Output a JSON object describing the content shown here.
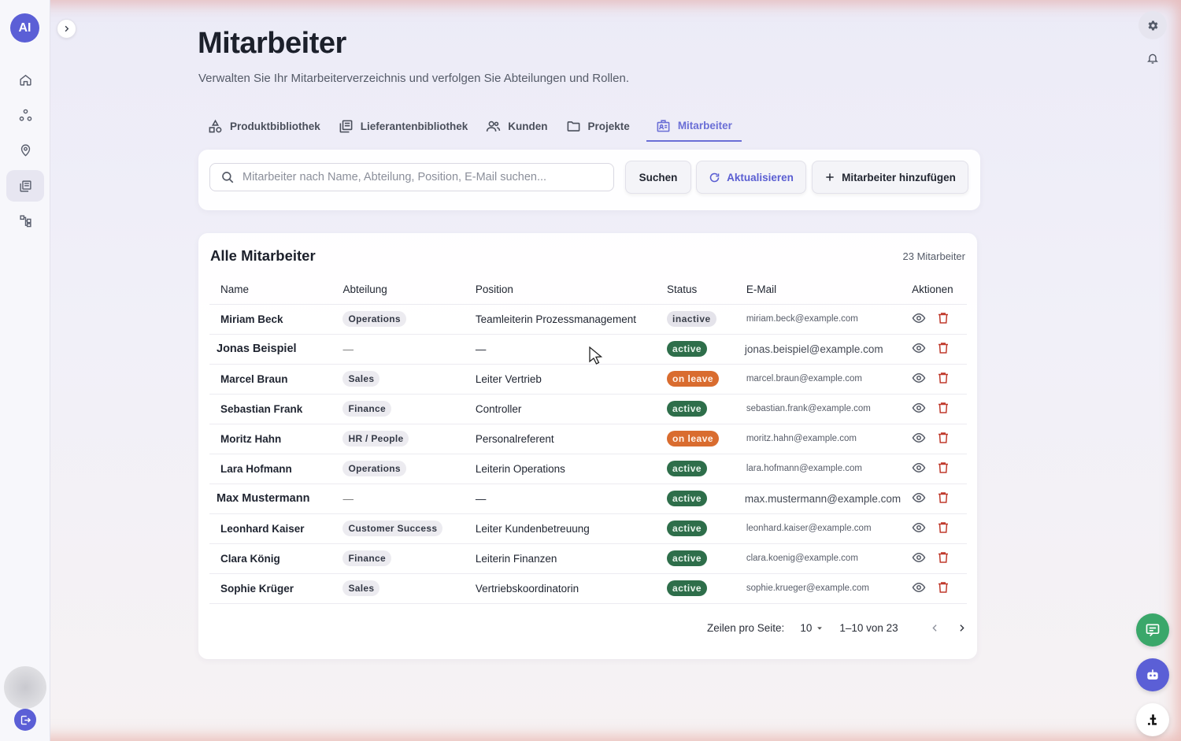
{
  "app": {
    "logo_text": "AI"
  },
  "sidebar": {
    "items": [
      {
        "name": "home",
        "icon": "home-icon"
      },
      {
        "name": "nodes",
        "icon": "nodes-icon"
      },
      {
        "name": "location",
        "icon": "location-icon"
      },
      {
        "name": "library",
        "icon": "library-icon",
        "active": true
      },
      {
        "name": "hierarchy",
        "icon": "hierarchy-icon"
      }
    ]
  },
  "header": {
    "title": "Mitarbeiter",
    "subtitle": "Verwalten Sie Ihr Mitarbeiterverzeichnis und verfolgen Sie Abteilungen und Rollen."
  },
  "tabs": [
    {
      "label": "Produktbibliothek",
      "icon": "shapes-icon"
    },
    {
      "label": "Lieferantenbibliothek",
      "icon": "book-icon"
    },
    {
      "label": "Kunden",
      "icon": "users-icon"
    },
    {
      "label": "Projekte",
      "icon": "folder-icon"
    },
    {
      "label": "Mitarbeiter",
      "icon": "badge-icon",
      "active": true
    }
  ],
  "search": {
    "placeholder": "Mitarbeiter nach Name, Abteilung, Position, E-Mail suchen...",
    "value": "",
    "search_label": "Suchen",
    "refresh_label": "Aktualisieren",
    "add_label": "Mitarbeiter hinzufügen"
  },
  "table": {
    "title": "Alle Mitarbeiter",
    "count": "23 Mitarbeiter",
    "columns": [
      "Name",
      "Abteilung",
      "Position",
      "Status",
      "E-Mail",
      "Aktionen"
    ],
    "rows": [
      {
        "name": "Miriam Beck",
        "department": "Operations",
        "position": "Teamleiterin Prozessmanagement",
        "status": "inactive",
        "email": "miriam.beck@example.com"
      },
      {
        "name": "Jonas Beispiel",
        "department": "—",
        "position": "—",
        "status": "active",
        "email": "jonas.beispiel@example.com"
      },
      {
        "name": "Marcel Braun",
        "department": "Sales",
        "position": "Leiter Vertrieb",
        "status": "on leave",
        "email": "marcel.braun@example.com"
      },
      {
        "name": "Sebastian Frank",
        "department": "Finance",
        "position": "Controller",
        "status": "active",
        "email": "sebastian.frank@example.com"
      },
      {
        "name": "Moritz Hahn",
        "department": "HR / People",
        "position": "Personalreferent",
        "status": "on leave",
        "email": "moritz.hahn@example.com"
      },
      {
        "name": "Lara Hofmann",
        "department": "Operations",
        "position": "Leiterin Operations",
        "status": "active",
        "email": "lara.hofmann@example.com"
      },
      {
        "name": "Max Mustermann",
        "department": "—",
        "position": "—",
        "status": "active",
        "email": "max.mustermann@example.com"
      },
      {
        "name": "Leonhard Kaiser",
        "department": "Customer Success",
        "position": "Leiter Kundenbetreuung",
        "status": "active",
        "email": "leonhard.kaiser@example.com"
      },
      {
        "name": "Clara König",
        "department": "Finance",
        "position": "Leiterin Finanzen",
        "status": "active",
        "email": "clara.koenig@example.com"
      },
      {
        "name": "Sophie Krüger",
        "department": "Sales",
        "position": "Vertriebskoordinatorin",
        "status": "active",
        "email": "sophie.krueger@example.com"
      }
    ]
  },
  "pagination": {
    "rows_label": "Zeilen pro Seite:",
    "rows_value": "10",
    "range": "1–10 von 23"
  },
  "colors": {
    "accent": "#5b5fd6",
    "active": "#2e6e4a",
    "on_leave": "#d96c2f",
    "inactive": "#e4e3ea",
    "delete": "#c0392b"
  }
}
